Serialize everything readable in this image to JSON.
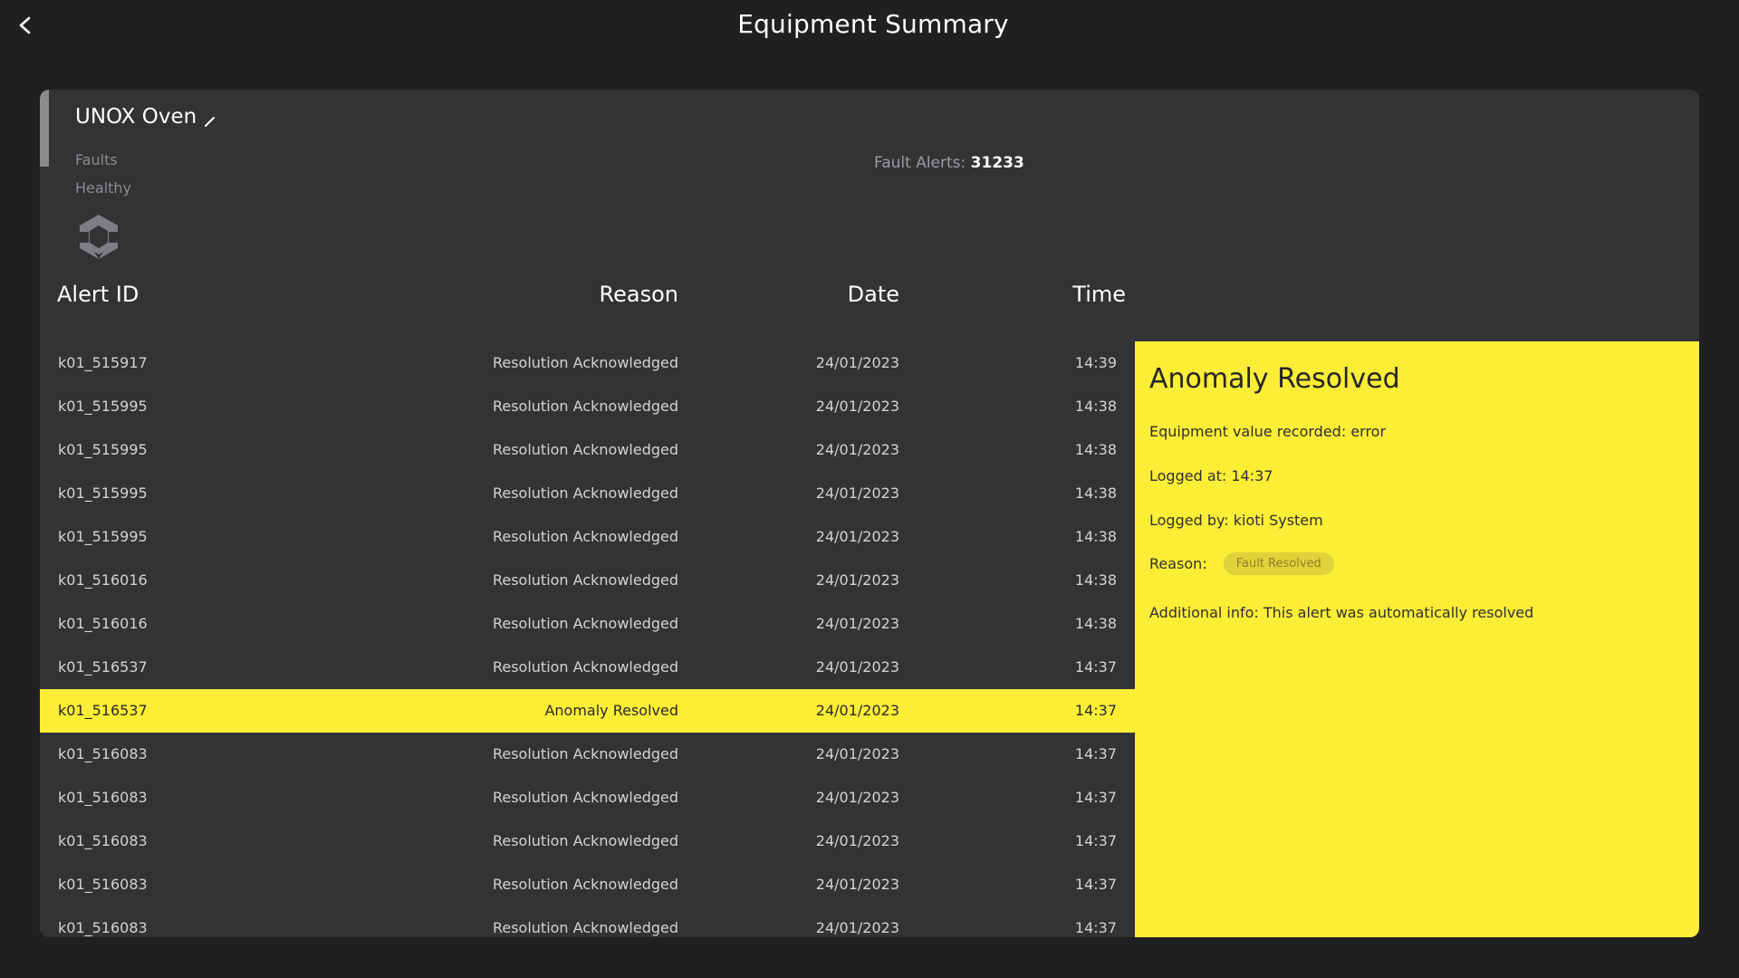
{
  "header": {
    "title": "Equipment Summary"
  },
  "equipment": {
    "name": "UNOX Oven",
    "faults_label": "Faults",
    "status_label": "Healthy",
    "fault_alerts_label": "Fault Alerts: ",
    "fault_alerts_count": "31233"
  },
  "table": {
    "headers": {
      "alert_id": "Alert ID",
      "reason": "Reason",
      "date": "Date",
      "time": "Time"
    },
    "rows": [
      {
        "id": "k01_515917",
        "reason": "Resolution Acknowledged",
        "date": "24/01/2023",
        "time": "14:39"
      },
      {
        "id": "k01_515995",
        "reason": "Resolution Acknowledged",
        "date": "24/01/2023",
        "time": "14:38"
      },
      {
        "id": "k01_515995",
        "reason": "Resolution Acknowledged",
        "date": "24/01/2023",
        "time": "14:38"
      },
      {
        "id": "k01_515995",
        "reason": "Resolution Acknowledged",
        "date": "24/01/2023",
        "time": "14:38"
      },
      {
        "id": "k01_515995",
        "reason": "Resolution Acknowledged",
        "date": "24/01/2023",
        "time": "14:38"
      },
      {
        "id": "k01_516016",
        "reason": "Resolution Acknowledged",
        "date": "24/01/2023",
        "time": "14:38"
      },
      {
        "id": "k01_516016",
        "reason": "Resolution Acknowledged",
        "date": "24/01/2023",
        "time": "14:38"
      },
      {
        "id": "k01_516537",
        "reason": "Resolution Acknowledged",
        "date": "24/01/2023",
        "time": "14:37"
      },
      {
        "id": "k01_516537",
        "reason": "Anomaly Resolved",
        "date": "24/01/2023",
        "time": "14:37",
        "selected": true
      },
      {
        "id": "k01_516083",
        "reason": "Resolution Acknowledged",
        "date": "24/01/2023",
        "time": "14:37"
      },
      {
        "id": "k01_516083",
        "reason": "Resolution Acknowledged",
        "date": "24/01/2023",
        "time": "14:37"
      },
      {
        "id": "k01_516083",
        "reason": "Resolution Acknowledged",
        "date": "24/01/2023",
        "time": "14:37"
      },
      {
        "id": "k01_516083",
        "reason": "Resolution Acknowledged",
        "date": "24/01/2023",
        "time": "14:37"
      },
      {
        "id": "k01_516083",
        "reason": "Resolution Acknowledged",
        "date": "24/01/2023",
        "time": "14:37"
      }
    ]
  },
  "detail": {
    "title": "Anomaly Resolved",
    "value_line": "Equipment value recorded: error",
    "logged_at": "Logged at: 14:37",
    "logged_by": "Logged by: kioti System",
    "reason_label": "Reason:",
    "reason_chip": "Fault Resolved",
    "additional_info": "Additional info: This alert was automatically resolved"
  },
  "colors": {
    "background": "#1f2022",
    "card": "#323335",
    "accent_yellow": "#fced36",
    "chip": "#e0d23a"
  },
  "icons": {
    "back": "chevron-left-icon",
    "edit": "pencil-icon",
    "logo": "hexagon-logo-icon"
  }
}
